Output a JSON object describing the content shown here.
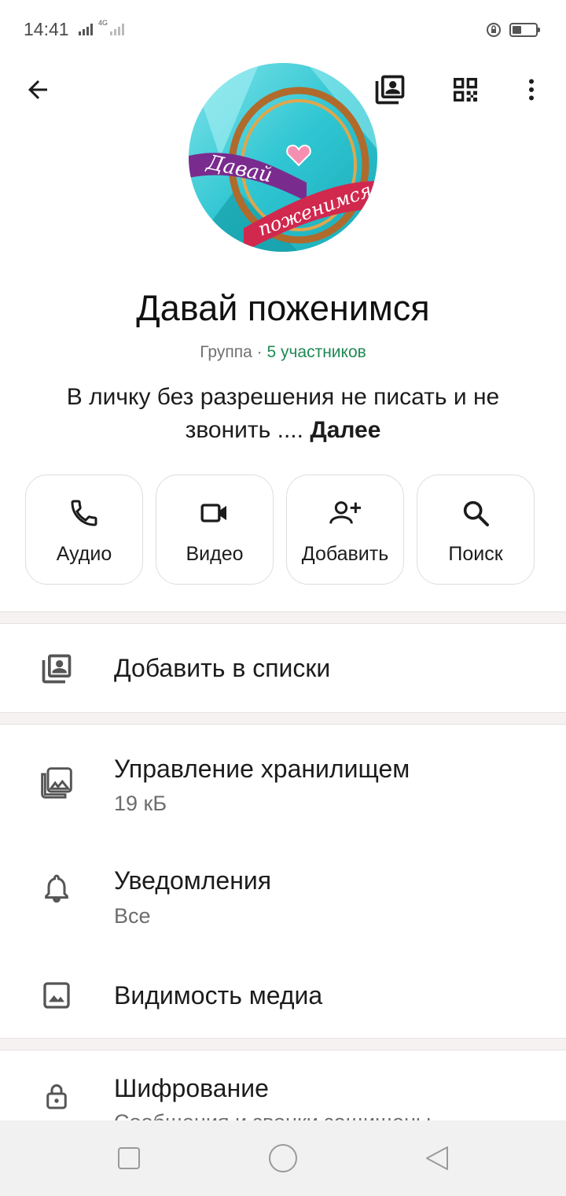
{
  "status_bar": {
    "time": "14:41",
    "network": "4G",
    "icons": [
      "signal-icon",
      "rotation-lock-icon",
      "battery-icon"
    ]
  },
  "header": {
    "back_icon": "arrow-left-icon",
    "lists_icon": "contact-list-icon",
    "qr_icon": "qr-code-icon",
    "more_icon": "more-vertical-icon",
    "avatar_text_line1": "Давай",
    "avatar_text_line2": "поженимся"
  },
  "group": {
    "name": "Давай поженимся",
    "type_label": "Группа",
    "separator": "·",
    "members_label": "5 участников",
    "description": "В личку без разрешения не писать и не звонить ....",
    "more_label": "Далее"
  },
  "actions": [
    {
      "label": "Аудио",
      "icon": "phone-icon"
    },
    {
      "label": "Видео",
      "icon": "video-camera-icon"
    },
    {
      "label": "Добавить",
      "icon": "add-person-icon"
    },
    {
      "label": "Поиск",
      "icon": "search-icon"
    }
  ],
  "menu": {
    "add_to_lists": {
      "title": "Добавить в списки",
      "icon": "contact-list-icon"
    },
    "storage": {
      "title": "Управление хранилищем",
      "subtitle": "19 кБ",
      "icon": "storage-media-icon"
    },
    "notifications": {
      "title": "Уведомления",
      "subtitle": "Все",
      "icon": "bell-icon"
    },
    "media_visibility": {
      "title": "Видимость медиа",
      "icon": "image-icon"
    },
    "encryption": {
      "title": "Шифрование",
      "subtitle": "Сообщения и звонки защищены",
      "icon": "lock-icon"
    }
  },
  "nav_bar": {
    "icons": [
      "recents-square-icon",
      "home-circle-icon",
      "back-triangle-icon"
    ]
  },
  "colors": {
    "accent_green": "#1f8a53",
    "divider": "#f6f2f2",
    "text_primary": "#1c1c1c",
    "text_secondary": "#6d6d6d"
  }
}
